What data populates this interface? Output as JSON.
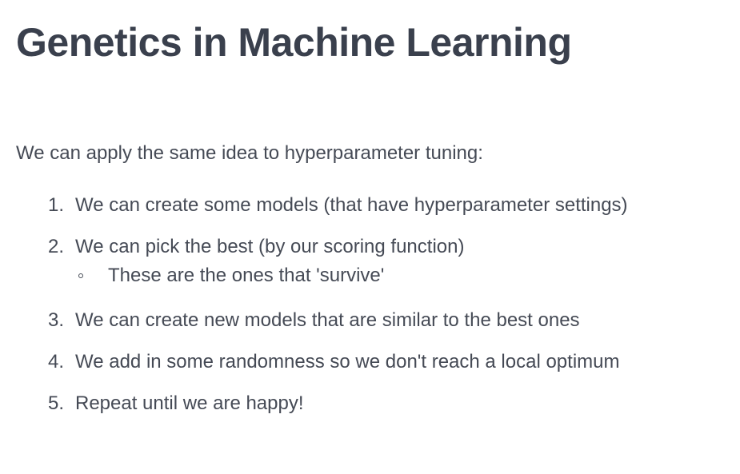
{
  "slide": {
    "title": "Genetics in Machine Learning",
    "intro": "We can apply the same idea to hyperparameter tuning:",
    "steps": [
      {
        "number": "1.",
        "text": "We can create some models (that have hyperparameter settings)"
      },
      {
        "number": "2.",
        "text": "We can pick the best (by our scoring function)",
        "sub": "These are the ones that 'survive'"
      },
      {
        "number": "3.",
        "text": "We can create new models that are similar to the best ones"
      },
      {
        "number": "4.",
        "text": "We add in some randomness so we don't reach a local optimum"
      },
      {
        "number": "5.",
        "text": "Repeat until we are happy!"
      }
    ]
  },
  "colors": {
    "title": "#3a404d",
    "body_text": "#454a55",
    "background": "#ffffff"
  },
  "icons": {
    "sub_bullet": "hollow-circle-bullet-icon"
  }
}
